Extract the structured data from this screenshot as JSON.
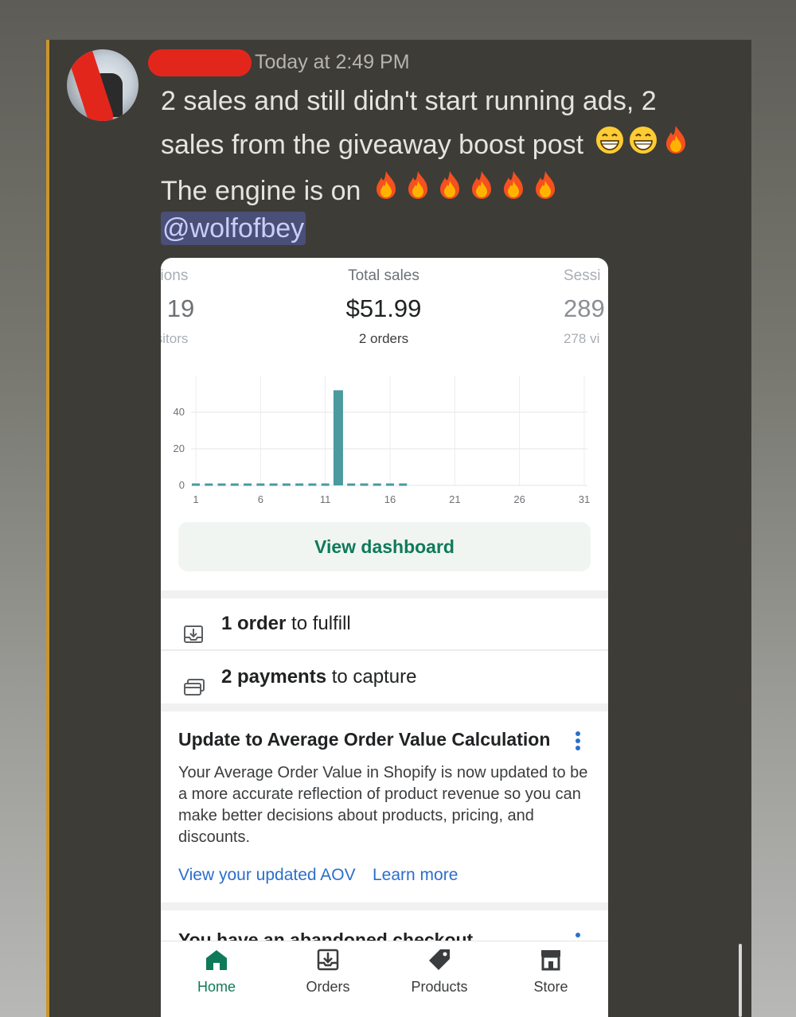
{
  "message": {
    "timestamp": "Today at 2:49 PM",
    "line1": "2 sales and still didn't start running ads, 2",
    "line2": "sales from the giveaway boost post",
    "line3": "The engine is on",
    "mention": "@wolfofbey",
    "emoji_line2": [
      "grin-icon",
      "grin-icon",
      "fire-icon"
    ],
    "emoji_line3": [
      "fire-icon",
      "fire-icon",
      "fire-icon",
      "fire-icon",
      "fire-icon",
      "fire-icon"
    ]
  },
  "stats": {
    "left": {
      "label": "sions",
      "value": "19",
      "sub": "isitors"
    },
    "center": {
      "label": "Total sales",
      "value": "$51.99",
      "sub": "2 orders"
    },
    "right": {
      "label": "Sessi",
      "value": "289",
      "sub": "278 vi"
    }
  },
  "chart_data": {
    "type": "bar",
    "x": [
      1,
      2,
      3,
      4,
      5,
      6,
      7,
      8,
      9,
      10,
      11,
      12,
      13,
      14,
      15,
      16,
      17,
      18,
      19,
      20,
      21,
      22,
      23,
      24,
      25,
      26,
      27,
      28,
      29,
      30,
      31
    ],
    "values": [
      0,
      0,
      0,
      0,
      0,
      0,
      0,
      0,
      0,
      0,
      0,
      52,
      0,
      0,
      0,
      0,
      0,
      null,
      null,
      null,
      null,
      null,
      null,
      null,
      null,
      null,
      null,
      null,
      null,
      null,
      null
    ],
    "x_ticks": [
      "1",
      "6",
      "11",
      "16",
      "21",
      "26",
      "31"
    ],
    "y_ticks": [
      "0",
      "20",
      "40"
    ],
    "ylim": [
      0,
      60
    ],
    "grid": true,
    "bar_color": "#4a9a9e"
  },
  "dashboard_button": "View dashboard",
  "tasks": [
    {
      "icon": "download-icon",
      "bold": "1 order",
      "rest": " to fulfill"
    },
    {
      "icon": "payment-icon",
      "bold": "2 payments",
      "rest": " to capture"
    }
  ],
  "notice": {
    "title": "Update to Average Order Value Calculation",
    "body": "Your Average Order Value in Shopify is now updated to be a more accurate reflection of product revenue so you can make better decisions about products, pricing, and discounts.",
    "link1": "View your updated AOV",
    "link2": "Learn more"
  },
  "cutoff_title": "You have an abandoned checkout",
  "tabs": [
    {
      "label": "Home",
      "icon": "home-icon",
      "active": true
    },
    {
      "label": "Orders",
      "icon": "orders-icon",
      "active": false
    },
    {
      "label": "Products",
      "icon": "tag-icon",
      "active": false
    },
    {
      "label": "Store",
      "icon": "store-icon",
      "active": false
    }
  ],
  "colors": {
    "accent": "#0f7a5a",
    "link": "#2c6ecb",
    "mention_bg": "#4a4f77",
    "redaction": "#e3261c"
  }
}
